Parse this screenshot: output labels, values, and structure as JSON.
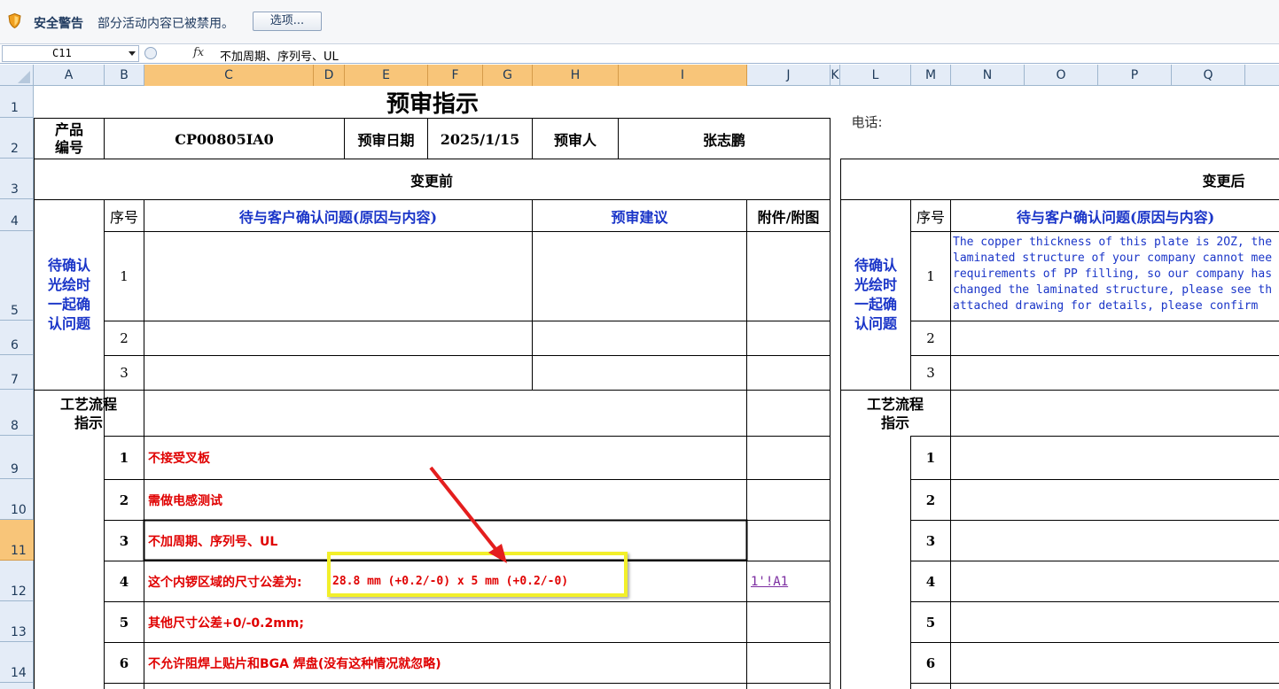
{
  "security_bar": {
    "title": "安全警告",
    "message": "部分活动内容已被禁用。",
    "options_button": "选项..."
  },
  "formula_bar": {
    "name_box": "C11",
    "fx": "fx",
    "formula": "不加周期、序列号、UL"
  },
  "columns": [
    "A",
    "B",
    "C",
    "D",
    "E",
    "F",
    "G",
    "H",
    "I",
    "J",
    "K",
    "L",
    "M",
    "N",
    "O",
    "P",
    "Q"
  ],
  "rows": [
    "1",
    "2",
    "3",
    "4",
    "5",
    "6",
    "7",
    "8",
    "9",
    "10",
    "11",
    "12",
    "13",
    "14"
  ],
  "sheet": {
    "title": "预审指示",
    "product_label": "产品\n编号",
    "product_no": "CP00805IA0",
    "review_date_label": "预审日期",
    "review_date": "2025/1/15",
    "reviewer_label": "预审人",
    "reviewer": "张志鹏",
    "phone_label": "电话:",
    "before_label": "变更前",
    "after_label": "变更后",
    "seq_label": "序号",
    "question_header": "待与客户确认问题(原因与内容)",
    "suggestion_header": "预审建议",
    "attach_header": "附件/附图",
    "confirm_label": "待确认\n光绘时\n一起确\n认问题",
    "q_nums": [
      "1",
      "2",
      "3"
    ],
    "process_label": "工艺流程\n指示",
    "process_nums": [
      "1",
      "2",
      "3",
      "4",
      "5",
      "6"
    ],
    "process_items": [
      "不接受叉板",
      "需做电感测试",
      "不加周期、序列号、UL",
      "这个内锣区域的尺寸公差为:",
      "其他尺寸公差+0/-0.2mm;",
      "不允许阻焊上贴片和BGA 焊盘(没有这种情况就忽略)"
    ],
    "tolerance_highlight": "28.8 mm (+0.2/-0) x 5 mm (+0.2/-0)",
    "link_text": "1'!A1",
    "english_note": [
      "The copper thickness of this plate is 2OZ, the",
      "laminated structure of your company cannot mee",
      "requirements of PP filling, so our company has",
      "changed the laminated structure, please see th",
      "attached drawing for details, please confirm"
    ]
  },
  "colors": {
    "accent_red": "#e00000",
    "accent_blue": "#1a35c8",
    "highlight_yellow": "#f2ef2a",
    "header_bg": "#e4ecf7",
    "selected_header": "#f8c579"
  }
}
